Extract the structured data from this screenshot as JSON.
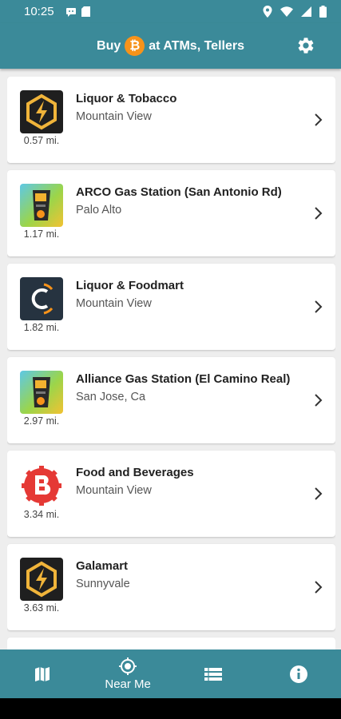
{
  "status_bar": {
    "time": "10:25"
  },
  "app_bar": {
    "title_prefix": "Buy",
    "coin_symbol": "₿",
    "title_suffix": "at ATMs, Tellers"
  },
  "locations": [
    {
      "name": "Liquor & Tobacco",
      "city": "Mountain View",
      "distance": "0.57 mi.",
      "logo": "lightning-hexagon-logo"
    },
    {
      "name": "ARCO Gas Station (San Antonio Rd)",
      "city": "Palo Alto",
      "distance": "1.17 mi.",
      "logo": "atm-machine-logo"
    },
    {
      "name": "Liquor & Foodmart",
      "city": "Mountain View",
      "distance": "1.82 mi.",
      "logo": "coinme-c-logo"
    },
    {
      "name": "Alliance Gas Station (El Camino Real)",
      "city": "San Jose, Ca",
      "distance": "2.97 mi.",
      "logo": "atm-machine-logo"
    },
    {
      "name": "Food and Beverages",
      "city": "Mountain View",
      "distance": "3.34 mi.",
      "logo": "red-b-badge-logo"
    },
    {
      "name": "Galamart",
      "city": "Sunnyvale",
      "distance": "3.63 mi.",
      "logo": "lightning-hexagon-logo"
    }
  ],
  "bottom_nav": {
    "items": [
      {
        "label": "",
        "icon": "map-icon"
      },
      {
        "label": "Near Me",
        "icon": "target-icon"
      },
      {
        "label": "",
        "icon": "list-icon"
      },
      {
        "label": "",
        "icon": "info-icon"
      }
    ]
  },
  "colors": {
    "primary": "#3b8a99",
    "bitcoin": "#f7931a"
  }
}
